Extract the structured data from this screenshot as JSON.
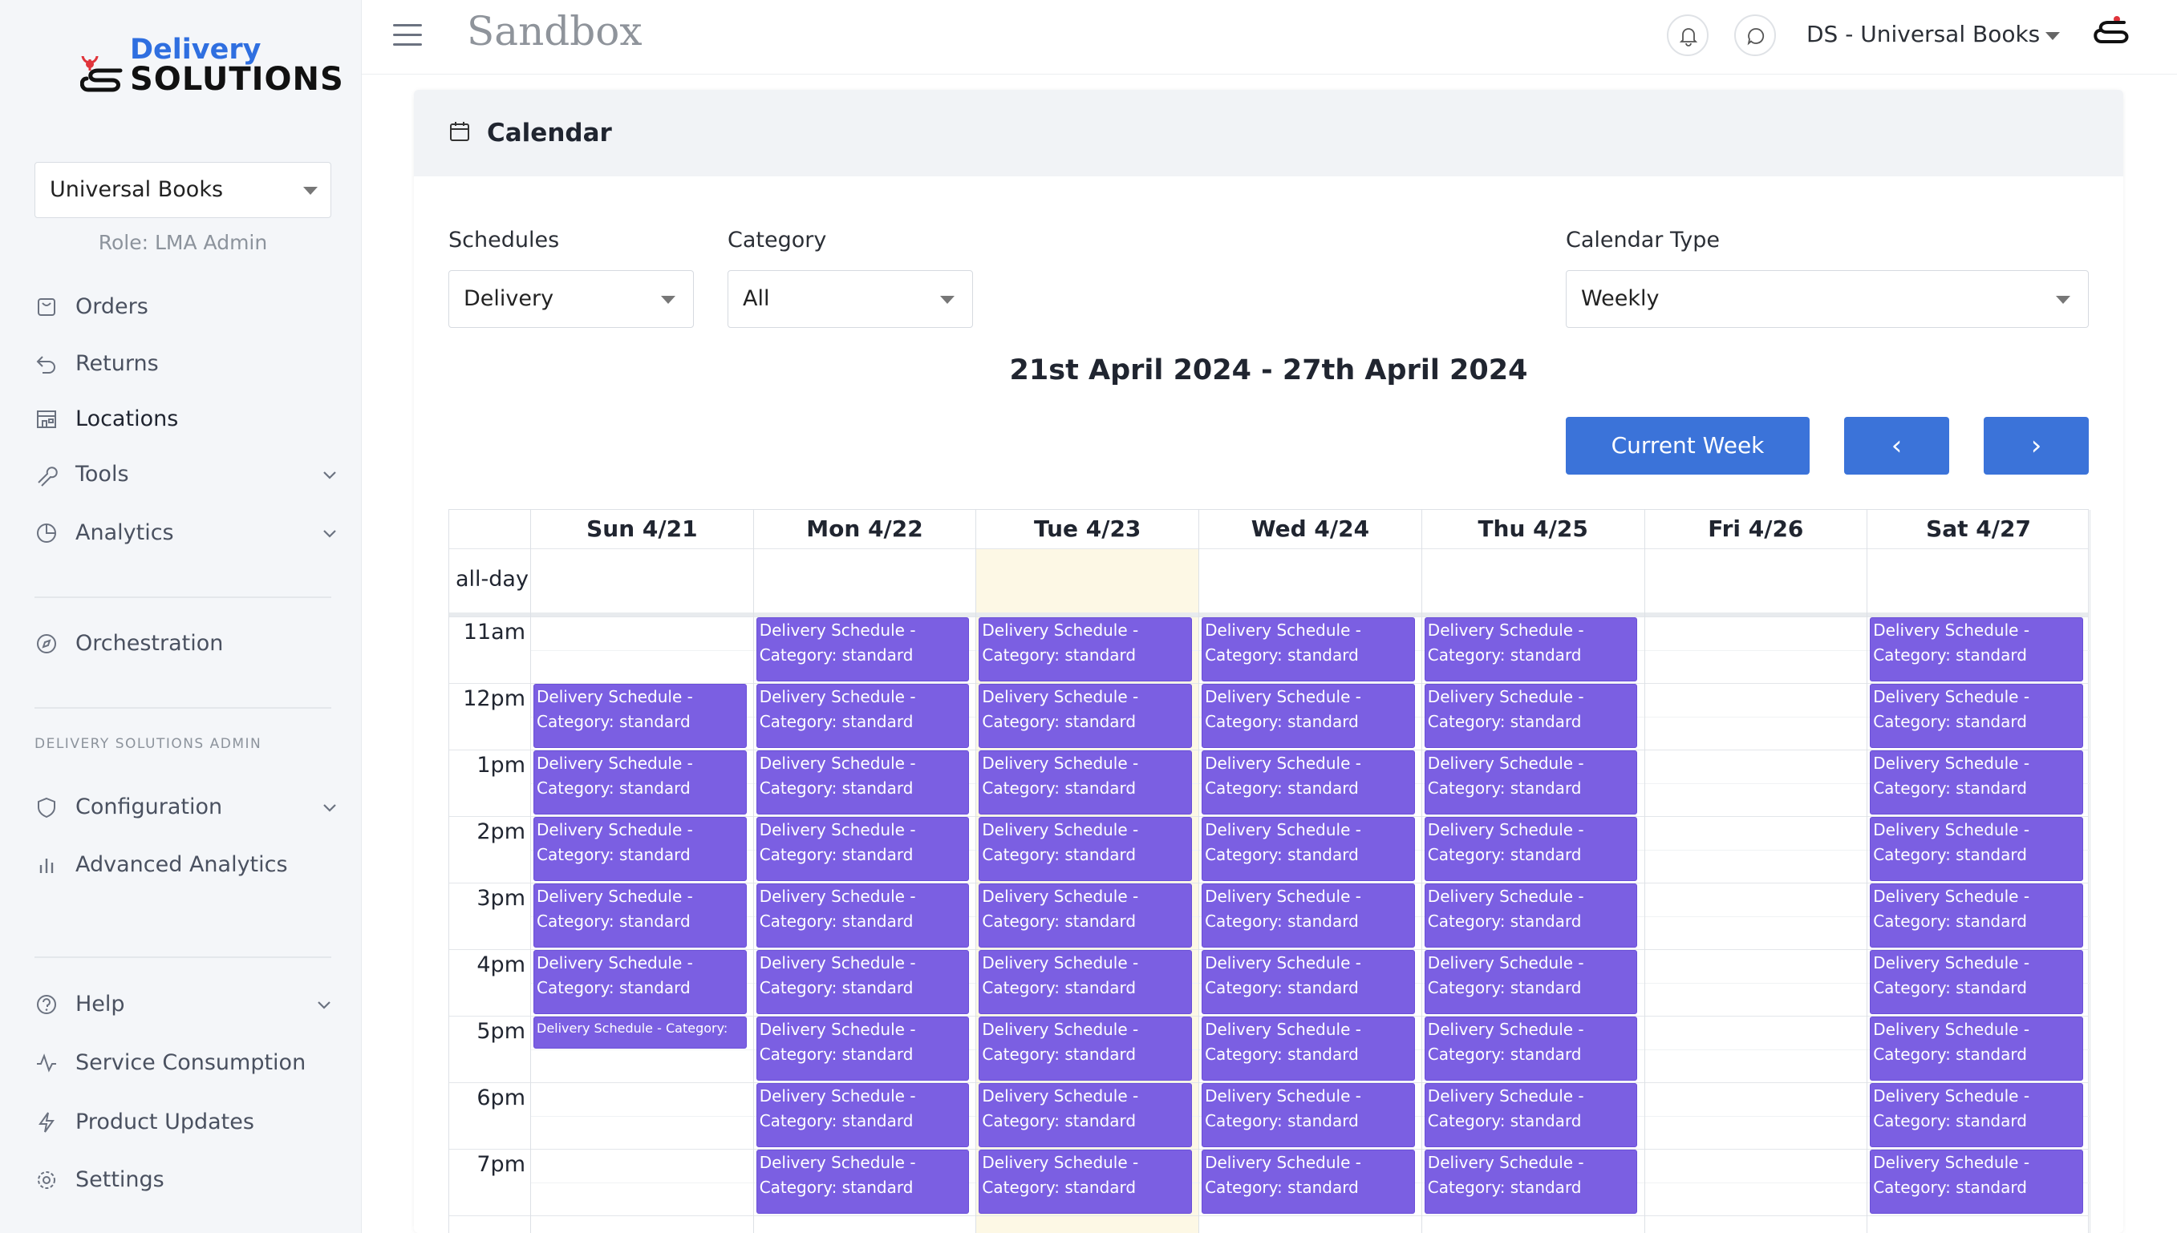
{
  "brand": {
    "logo_top": "Delivery",
    "logo_bottom": "SOLUTIONS"
  },
  "sidebar": {
    "org_select": "Universal Books",
    "role": "Role: LMA Admin",
    "items": [
      {
        "label": "Orders",
        "icon": "orders-icon"
      },
      {
        "label": "Returns",
        "icon": "return-icon"
      },
      {
        "label": "Locations",
        "icon": "store-icon"
      },
      {
        "label": "Tools",
        "icon": "wrench-icon"
      },
      {
        "label": "Analytics",
        "icon": "pie-chart-icon"
      },
      {
        "label": "Orchestration",
        "icon": "compass-icon"
      }
    ],
    "admin_section_label": "DELIVERY SOLUTIONS ADMIN",
    "admin_items": [
      {
        "label": "Configuration",
        "icon": "shield-icon"
      },
      {
        "label": "Advanced Analytics",
        "icon": "bar-chart-icon"
      }
    ],
    "bottom_items": [
      {
        "label": "Help",
        "icon": "help-icon"
      },
      {
        "label": "Service Consumption",
        "icon": "activity-icon"
      },
      {
        "label": "Product Updates",
        "icon": "lightning-icon"
      },
      {
        "label": "Settings",
        "icon": "gear-icon"
      }
    ]
  },
  "topbar": {
    "env": "Sandbox",
    "org_name": "DS - Universal Books"
  },
  "page": {
    "title": "Calendar"
  },
  "filters": {
    "schedules_label": "Schedules",
    "schedules_value": "Delivery",
    "category_label": "Category",
    "category_value": "All",
    "calendar_type_label": "Calendar Type",
    "calendar_type_value": "Weekly"
  },
  "calendar": {
    "range_title": "21st April 2024 - 27th April 2024",
    "current_week_label": "Current Week",
    "prev_label": "‹",
    "next_label": "›",
    "allday_label": "all-day",
    "days": [
      "Sun 4/21",
      "Mon 4/22",
      "Tue 4/23",
      "Wed 4/24",
      "Thu 4/25",
      "Fri 4/26",
      "Sat 4/27"
    ],
    "today_index": 2,
    "times": [
      "11am",
      "12pm",
      "1pm",
      "2pm",
      "3pm",
      "4pm",
      "5pm",
      "6pm",
      "7pm"
    ],
    "event_line1": "Delivery Schedule -",
    "event_line2": "Category: standard",
    "event_short": "Delivery Schedule - Category:",
    "events": [
      {
        "day": 0,
        "slots": [
          1,
          2,
          3,
          4,
          5
        ],
        "short_slot": 6
      },
      {
        "day": 1,
        "slots": [
          0,
          1,
          2,
          3,
          4,
          5,
          6,
          7,
          8
        ]
      },
      {
        "day": 2,
        "slots": [
          0,
          1,
          2,
          3,
          4,
          5,
          6,
          7,
          8
        ]
      },
      {
        "day": 3,
        "slots": [
          0,
          1,
          2,
          3,
          4,
          5,
          6,
          7,
          8
        ]
      },
      {
        "day": 4,
        "slots": [
          0,
          1,
          2,
          3,
          4,
          5,
          6,
          7,
          8
        ]
      },
      {
        "day": 6,
        "slots": [
          0,
          1,
          2,
          3,
          4,
          5,
          6,
          7,
          8
        ]
      }
    ]
  },
  "colors": {
    "accent": "#3b73d9",
    "event": "#7b5fe2",
    "today": "#fdf8e5",
    "sidebar_bg": "#f4f6f9"
  }
}
